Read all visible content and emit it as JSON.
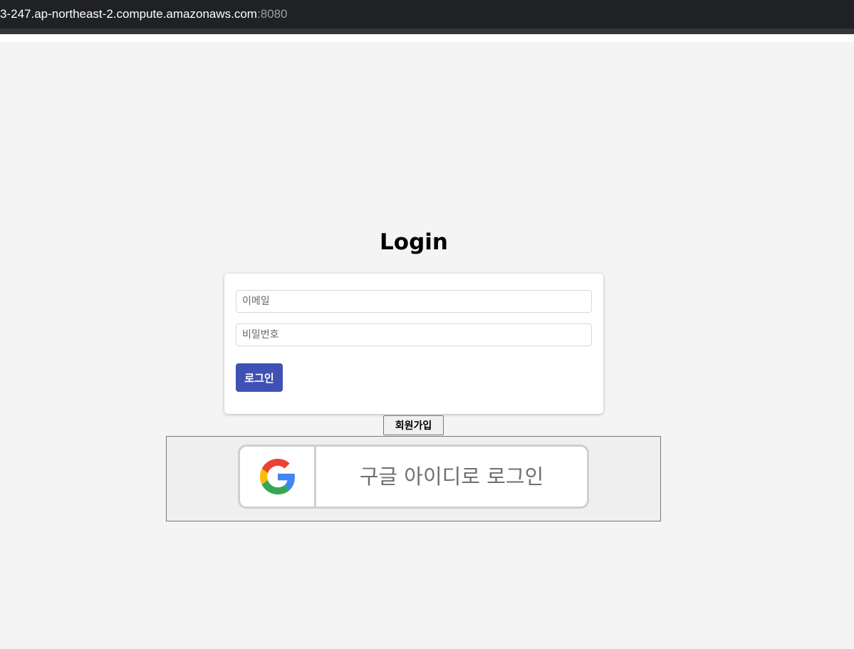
{
  "browser": {
    "address_host": "3-247.ap-northeast-2.compute.amazonaws.com",
    "address_port": ":8080"
  },
  "page": {
    "title": "Login"
  },
  "login_form": {
    "email_placeholder": "이메일",
    "email_value": "",
    "password_placeholder": "비밀번호",
    "password_value": "",
    "login_label": "로그인"
  },
  "signup": {
    "label": "회원가입"
  },
  "google_login": {
    "label": "구글 아이디로 로그인",
    "icon": "google-g-icon"
  },
  "colors": {
    "login_button": "#3f51b5",
    "background": "#f4f4f4"
  }
}
